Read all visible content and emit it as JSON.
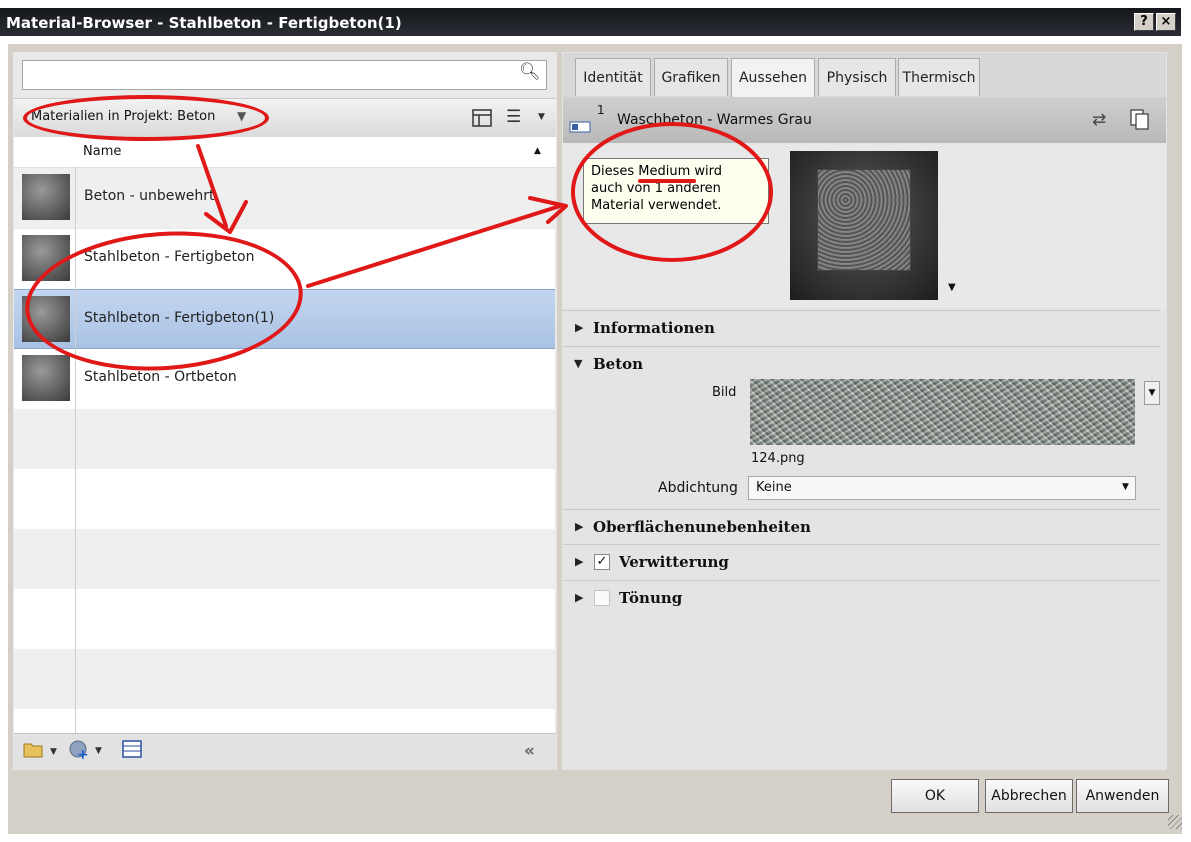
{
  "window": {
    "title": "Material-Browser - Stahlbeton - Fertigbeton(1)",
    "help_glyph": "?",
    "close_glyph": "×"
  },
  "search": {
    "placeholder": "",
    "icon": "magnifier-icon"
  },
  "library": {
    "label": "Materialien in Projekt: Beton",
    "column_header": "Name",
    "materials": [
      {
        "label": "Beton - unbewehrt",
        "selected": false
      },
      {
        "label": "Stahlbeton - Fertigbeton",
        "selected": false
      },
      {
        "label": "Stahlbeton - Fertigbeton(1)",
        "selected": true
      },
      {
        "label": "Stahlbeton - Ortbeton",
        "selected": false
      }
    ],
    "collapse_glyph": "«"
  },
  "tabs": [
    {
      "label": "Identität",
      "active": false
    },
    {
      "label": "Grafiken",
      "active": false
    },
    {
      "label": "Aussehen",
      "active": true
    },
    {
      "label": "Physisch",
      "active": false
    },
    {
      "label": "Thermisch",
      "active": false
    }
  ],
  "asset": {
    "usage_count": "1",
    "name": "Waschbeton - Warmes Grau"
  },
  "tooltip": {
    "line1": "Dieses Medium wird",
    "line2": "auch von 1 anderen",
    "line3": "Material verwendet."
  },
  "sections": {
    "informationen": "Informationen",
    "beton": "Beton",
    "bild_label": "Bild",
    "bild_file": "124.png",
    "abdichtung_label": "Abdichtung",
    "abdichtung_value": "Keine",
    "oberflaechen": "Oberflächenunebenheiten",
    "verwitterung": "Verwitterung",
    "verwitterung_checked": true,
    "toenung": "Tönung",
    "toenung_checked": false
  },
  "buttons": {
    "ok": "OK",
    "cancel": "Abbrechen",
    "apply": "Anwenden"
  },
  "annotation_color": "#e01818"
}
